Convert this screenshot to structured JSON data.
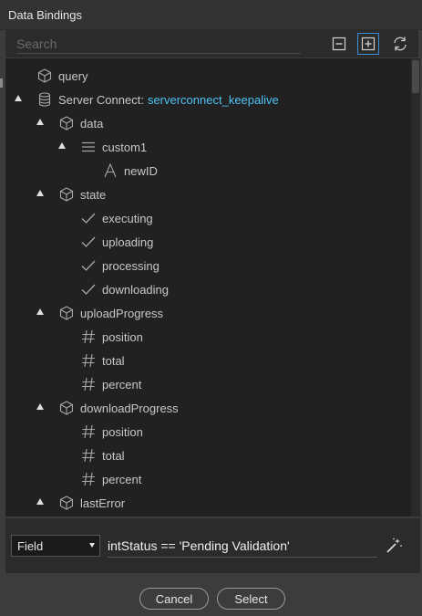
{
  "window": {
    "title": "Data Bindings"
  },
  "search": {
    "placeholder": "Search"
  },
  "tree": {
    "query": "query",
    "server_connect_prefix": "Server Connect:",
    "server_connect_name": "serverconnect_keepalive",
    "data": "data",
    "custom1": "custom1",
    "newID": "newID",
    "state": "state",
    "executing": "executing",
    "uploading": "uploading",
    "processing": "processing",
    "downloading": "downloading",
    "uploadProgress": "uploadProgress",
    "up_position": "position",
    "up_total": "total",
    "up_percent": "percent",
    "downloadProgress": "downloadProgress",
    "down_position": "position",
    "down_total": "total",
    "down_percent": "percent",
    "lastError": "lastError"
  },
  "expression": {
    "type_selected": "Field",
    "value": "intStatus == 'Pending Validation'"
  },
  "footer": {
    "cancel_label": "Cancel",
    "select_label": "Select"
  },
  "colors": {
    "accent": "#4fc3f7",
    "active_border": "#3b8ed9",
    "tree_bg": "#212121"
  },
  "icons": [
    "collapse-all-icon",
    "expand-all-icon",
    "refresh-icon",
    "cube-icon",
    "database-icon",
    "list-icon",
    "text-icon",
    "check-icon",
    "hash-icon",
    "magic-wand-icon"
  ]
}
